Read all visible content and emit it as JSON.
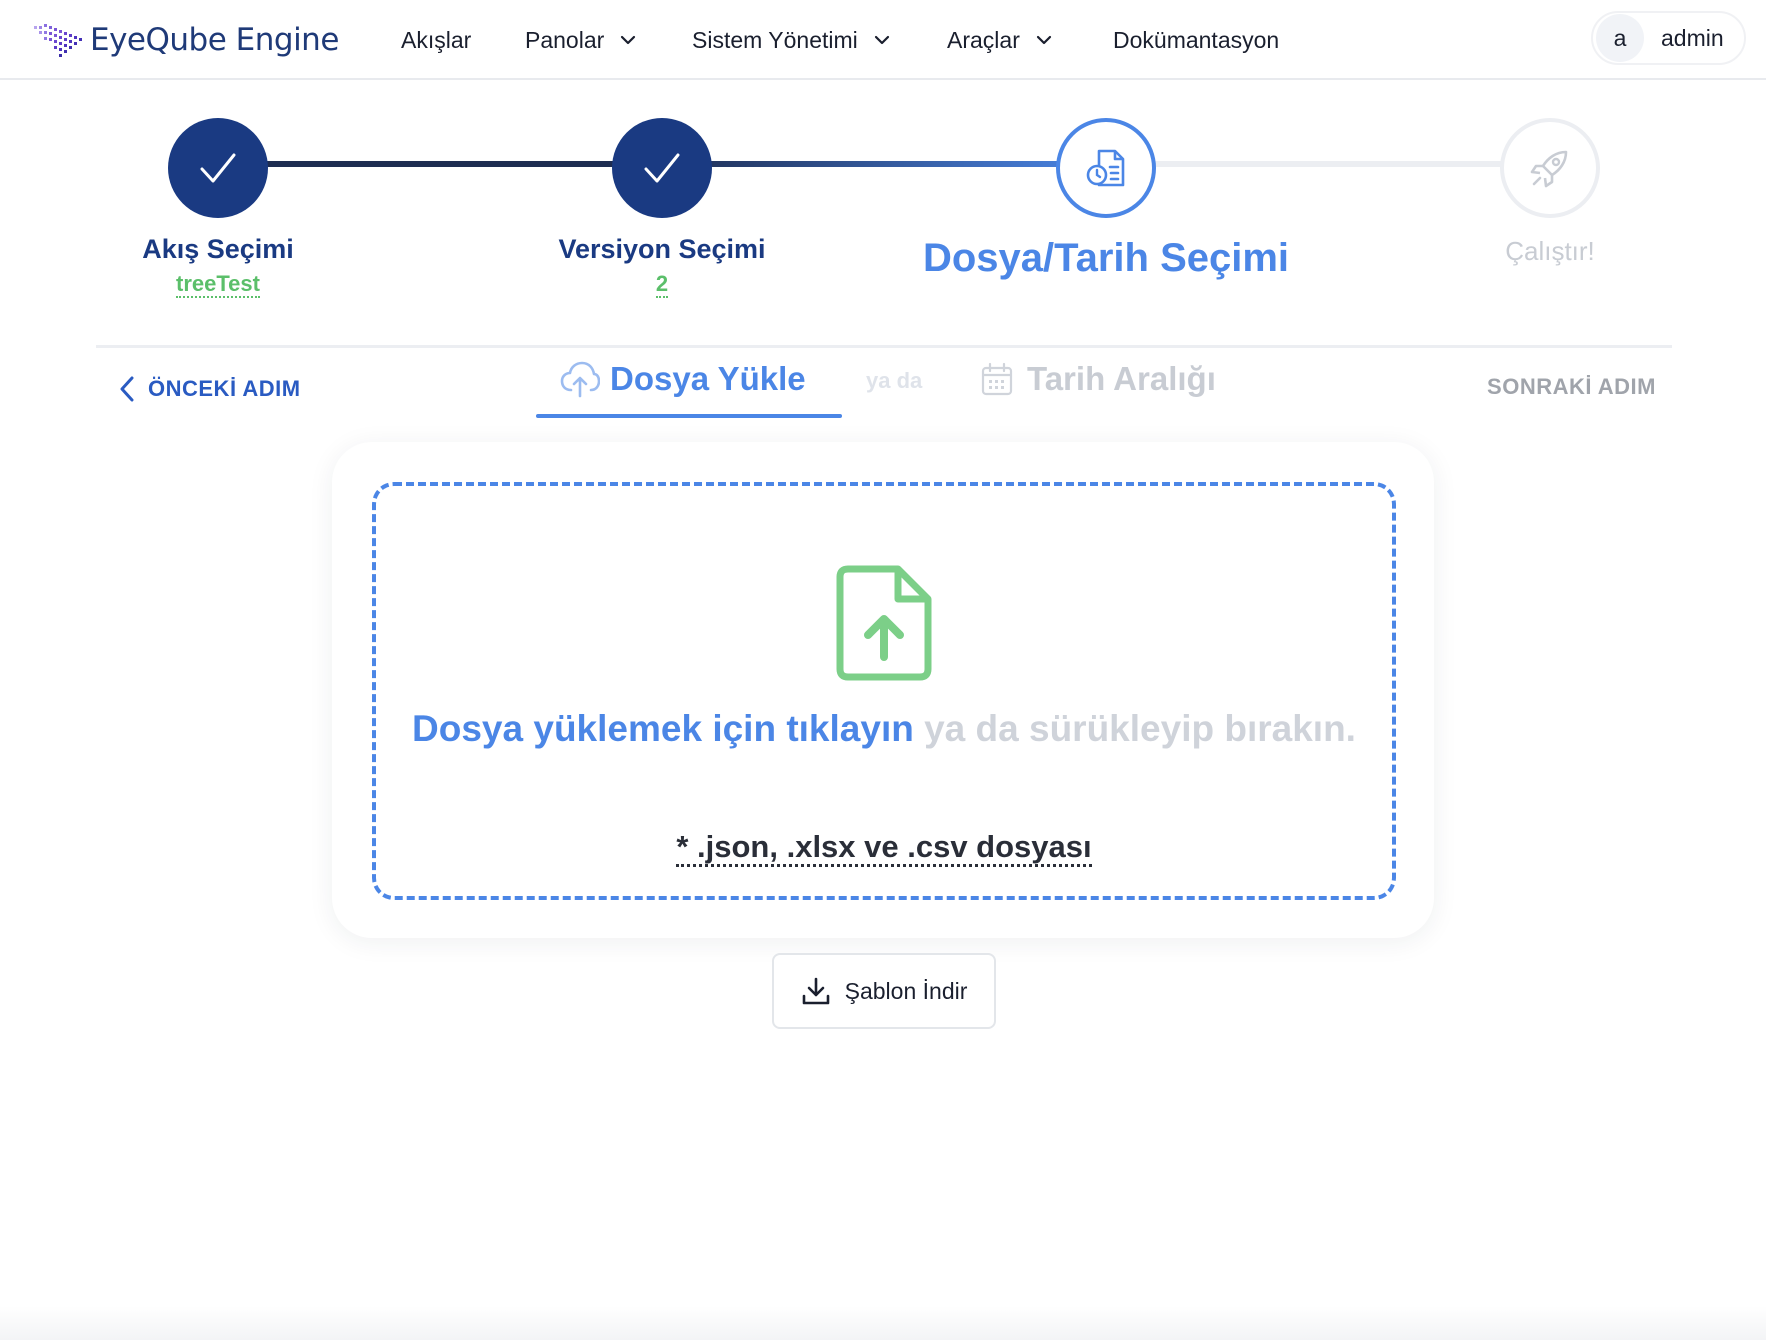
{
  "app": {
    "name": "EyeQube Engine"
  },
  "nav": {
    "items": [
      {
        "label": "Akışlar",
        "has_dropdown": false
      },
      {
        "label": "Panolar",
        "has_dropdown": true
      },
      {
        "label": "Sistem Yönetimi",
        "has_dropdown": true
      },
      {
        "label": "Araçlar",
        "has_dropdown": true
      },
      {
        "label": "Dokümantasyon",
        "has_dropdown": false
      }
    ]
  },
  "user": {
    "avatar_letter": "a",
    "name": "admin"
  },
  "stepper": {
    "steps": [
      {
        "title": "Akış Seçimi",
        "value": "treeTest",
        "state": "done"
      },
      {
        "title": "Versiyon Seçimi",
        "value": "2",
        "state": "done"
      },
      {
        "title": "Dosya/Tarih Seçimi",
        "state": "active"
      },
      {
        "title": "Çalıştır!",
        "state": "pending"
      }
    ]
  },
  "controls": {
    "prev_label": "ÖNCEKİ ADIM",
    "next_label": "SONRAKİ ADIM",
    "tab_upload": "Dosya Yükle",
    "or_text": "ya da",
    "tab_date": "Tarih Aralığı",
    "active_tab": "Dosya Yükle"
  },
  "upload": {
    "click_text": "Dosya yüklemek için tıklayın",
    "rest_text": "ya da sürükleyip bırakın.",
    "accept_text": "* .json, .xlsx ve .csv dosyası"
  },
  "template_button": {
    "label": "Şablon İndir"
  },
  "colors": {
    "primary_dark": "#1a3a82",
    "accent_blue": "#4b86e6",
    "success_green": "#5bbf6a",
    "muted_gray": "#c8ccd3"
  },
  "icons": {
    "brand": "eyeqube-logo-icon",
    "step_done": "check-icon",
    "step_active": "document-clock-icon",
    "step_pending": "rocket-icon",
    "upload_tab": "cloud-upload-icon",
    "date_tab": "calendar-icon",
    "dropzone": "file-upload-icon",
    "template": "download-icon"
  }
}
